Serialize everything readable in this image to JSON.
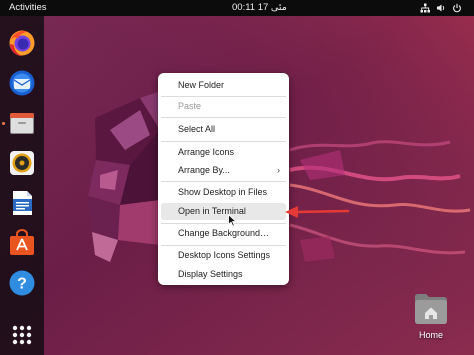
{
  "topbar": {
    "activities_label": "Activities",
    "clock_text": "00:11  مئی 17"
  },
  "dock": {
    "items": [
      {
        "name": "Firefox",
        "icon": "firefox-icon"
      },
      {
        "name": "Thunderbird",
        "icon": "thunderbird-icon"
      },
      {
        "name": "Files",
        "icon": "files-icon"
      },
      {
        "name": "Rhythmbox",
        "icon": "rhythmbox-icon"
      },
      {
        "name": "LibreOffice Writer",
        "icon": "writer-icon"
      },
      {
        "name": "Ubuntu Software",
        "icon": "software-icon"
      },
      {
        "name": "Help",
        "icon": "help-icon"
      },
      {
        "name": "Show Applications",
        "icon": "app-grid-icon"
      }
    ],
    "help_glyph": "?"
  },
  "menu": {
    "new_folder": "New Folder",
    "paste": "Paste",
    "select_all": "Select All",
    "arrange_icons": "Arrange Icons",
    "arrange_by": "Arrange By...",
    "show_desktop_in_files": "Show Desktop in Files",
    "open_in_terminal": "Open in Terminal",
    "change_background": "Change Background…",
    "desktop_icons_settings": "Desktop Icons Settings",
    "display_settings": "Display Settings"
  },
  "desktop": {
    "home_label": "Home"
  },
  "colors": {
    "accent": "#e95420",
    "annotation": "#e53935",
    "topbar": "#0c0c0c",
    "menu_bg": "#ffffff"
  }
}
